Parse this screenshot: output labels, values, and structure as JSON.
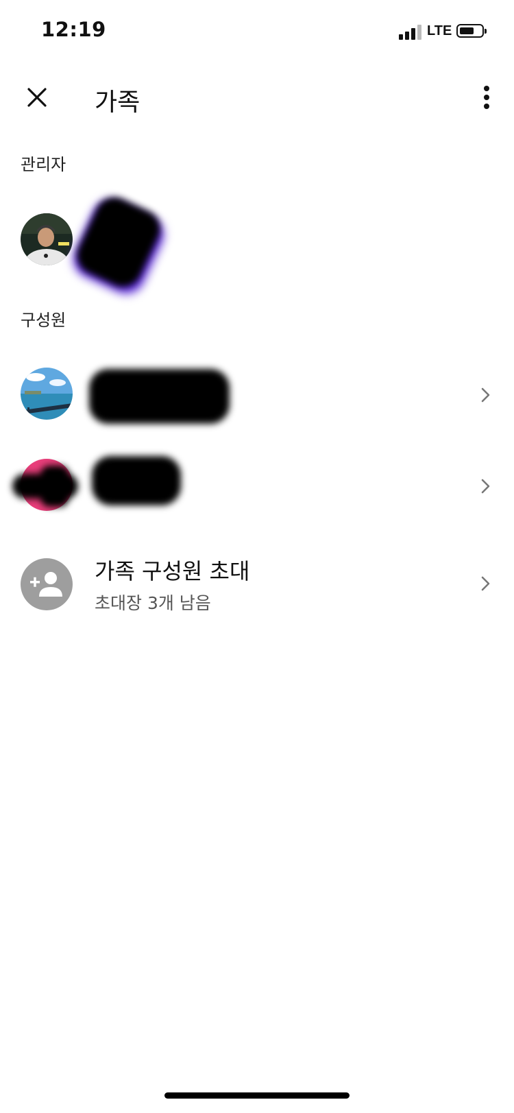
{
  "status": {
    "time": "12:19",
    "network": "LTE"
  },
  "header": {
    "title": "가족"
  },
  "sections": {
    "admin_label": "관리자",
    "members_label": "구성원"
  },
  "invite": {
    "title": "가족 구성원 초대",
    "subtitle": "초대장 3개 남음"
  },
  "colors": {
    "accent_purple": "#5b2bd6",
    "member2_avatar": "#e83e7a",
    "invite_avatar": "#9e9e9e"
  },
  "icons": {
    "close": "close-icon",
    "more": "more-vert-icon",
    "chevron": "chevron-right-icon",
    "add_person": "person-add-icon"
  }
}
